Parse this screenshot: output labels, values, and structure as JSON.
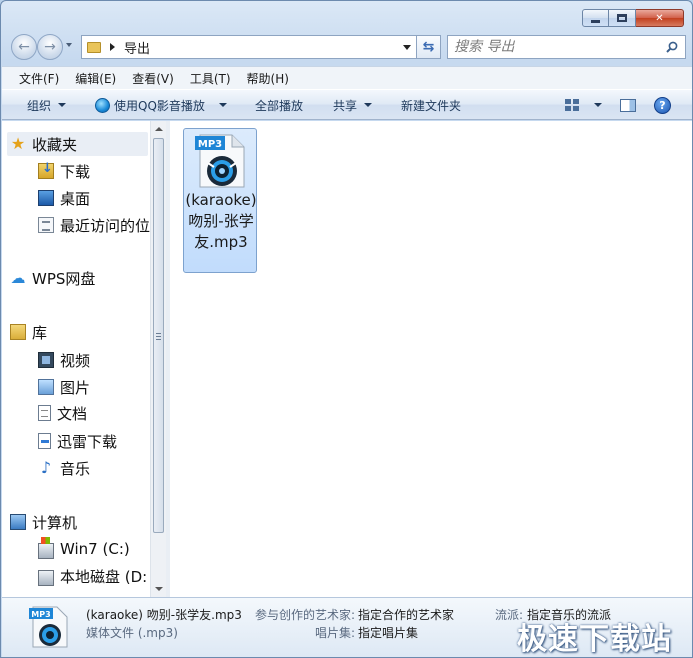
{
  "window": {
    "minimize": "minimize",
    "maximize": "maximize",
    "close": "✕"
  },
  "address": {
    "path": "导出"
  },
  "search": {
    "placeholder": "搜索 导出"
  },
  "menu": [
    "文件(F)",
    "编辑(E)",
    "查看(V)",
    "工具(T)",
    "帮助(H)"
  ],
  "toolbar": {
    "organize": "组织",
    "play_with": "使用QQ影音播放",
    "play_all": "全部播放",
    "share": "共享",
    "new_folder": "新建文件夹"
  },
  "nav": {
    "favorites": "收藏夹",
    "downloads": "下载",
    "desktop": "桌面",
    "recent": "最近访问的位",
    "wps": "WPS网盘",
    "libraries": "库",
    "videos": "视频",
    "pictures": "图片",
    "documents": "文档",
    "xunlei": "迅雷下载",
    "music": "音乐",
    "computer": "计算机",
    "win7": "Win7 (C:)",
    "local_disk": "本地磁盘 (D:"
  },
  "file": {
    "badge": "MP3",
    "name": "(karaoke) 吻别-张学友.mp3"
  },
  "details": {
    "filename": "(karaoke) 吻别-张学友.mp3",
    "type": "媒体文件 (.mp3)",
    "artist_label": "参与创作的艺术家:",
    "artist_value": "指定合作的艺术家",
    "album_label": "唱片集:",
    "album_value": "指定唱片集",
    "genre_label": "流派:",
    "genre_value": "指定音乐的流派"
  },
  "watermark": "极速下载站",
  "colors": {
    "selection": "#c1dcfc",
    "accent": "#1e395b",
    "close": "#c2401f"
  }
}
